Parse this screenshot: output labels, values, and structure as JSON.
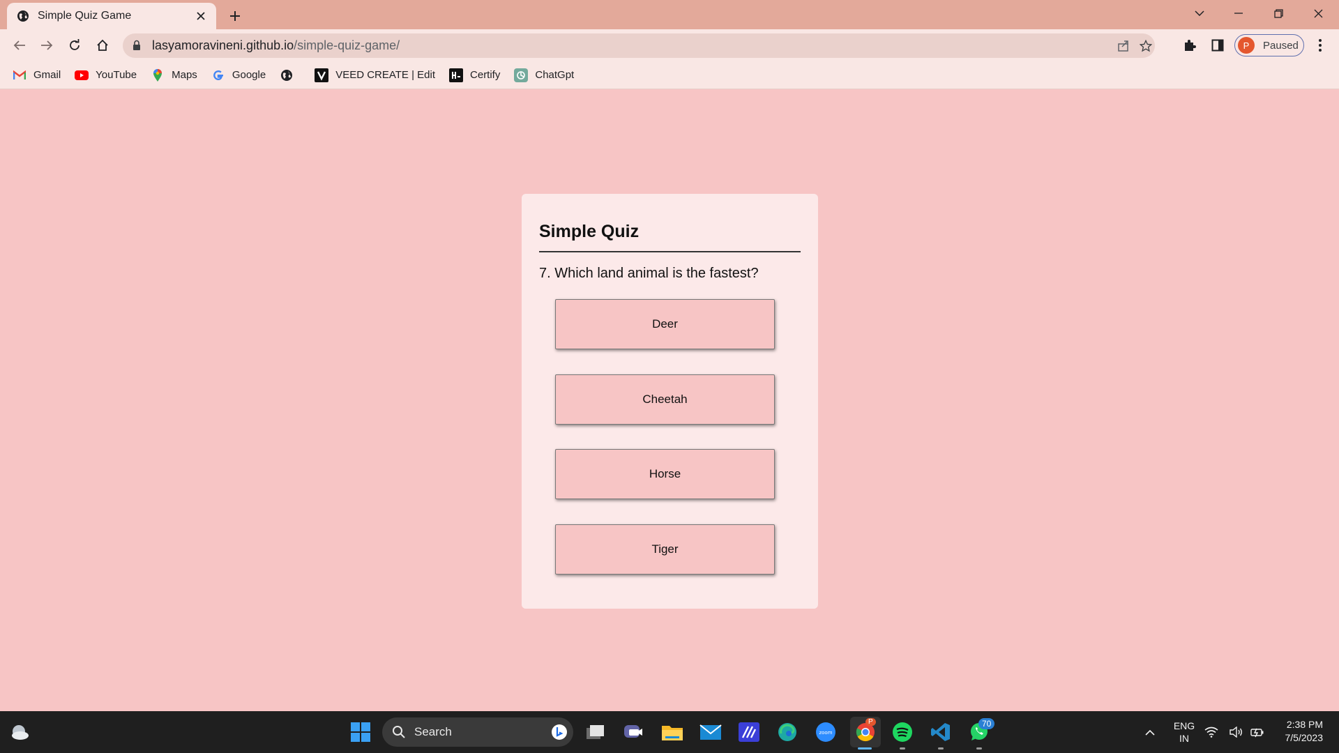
{
  "browser": {
    "tab_title": "Simple Quiz Game",
    "url_host": "lasyamoravineni.github.io",
    "url_path": "/simple-quiz-game/",
    "profile_initial": "P",
    "profile_status": "Paused",
    "bookmarks": [
      {
        "label": "Gmail",
        "icon": "gmail-icon"
      },
      {
        "label": "YouTube",
        "icon": "youtube-icon"
      },
      {
        "label": "Maps",
        "icon": "maps-icon"
      },
      {
        "label": "Google",
        "icon": "google-icon"
      },
      {
        "label": "",
        "icon": "globe-icon"
      },
      {
        "label": "VEED CREATE | Edit",
        "icon": "veed-icon"
      },
      {
        "label": "Certify",
        "icon": "certify-icon"
      },
      {
        "label": "ChatGpt",
        "icon": "chatgpt-icon"
      }
    ]
  },
  "quiz": {
    "title": "Simple Quiz",
    "question": "7. Which land animal is the fastest?",
    "answers": [
      "Deer",
      "Cheetah",
      "Horse",
      "Tiger"
    ]
  },
  "taskbar": {
    "search_label": "Search",
    "chrome_badge": "P",
    "whatsapp_badge": "70",
    "lang_line1": "ENG",
    "lang_line2": "IN",
    "time": "2:38 PM",
    "date": "7/5/2023"
  },
  "colors": {
    "page_bg": "#f7c5c5",
    "card_bg": "#fce9e9",
    "answer_bg": "#f7c5c5",
    "tabstrip": "#e3a99a"
  }
}
